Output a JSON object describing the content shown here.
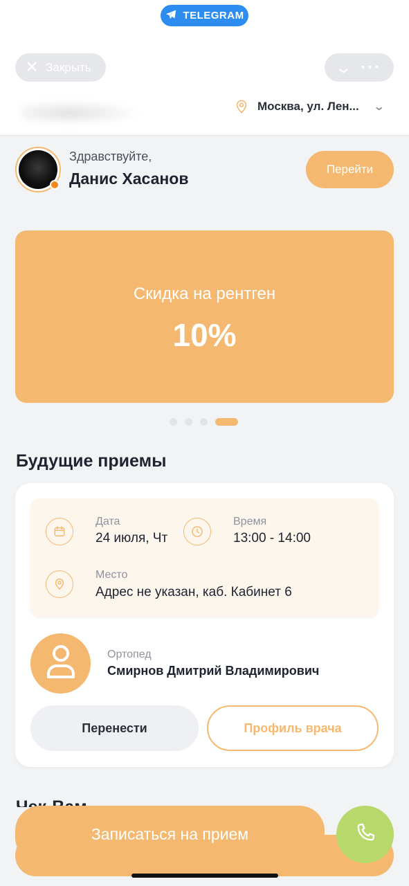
{
  "telegram": {
    "badge": "TELEGRAM"
  },
  "header": {
    "close_label": "Закрыть",
    "location": "Москва, ул. Лен..."
  },
  "greeting": {
    "hello": "Здравствуйте,",
    "name": "Данис Хасанов",
    "go_label": "Перейти"
  },
  "banner": {
    "title": "Скидка на рентген",
    "value": "10%",
    "page_count": 4,
    "active_page": 4
  },
  "appointments": {
    "section_title": "Будущие приемы",
    "date_label": "Дата",
    "date_value": "24 июля, Чт",
    "time_label": "Время",
    "time_value": "13:00 - 14:00",
    "place_label": "Место",
    "place_value": "Адрес не указан, каб. Кабинет 6",
    "doctor_role": "Ортопед",
    "doctor_name": "Смирнов Дмитрий Владимирович",
    "reschedule_label": "Перенести",
    "profile_label": "Профиль врача"
  },
  "next_section_title": "Чек-Вам",
  "bottom": {
    "book_label": "Записаться на прием"
  },
  "colors": {
    "accent": "#f4b870",
    "telegram_blue": "#2d8cf0",
    "call_green": "#b7d96b",
    "background": "#f2f3f5"
  }
}
